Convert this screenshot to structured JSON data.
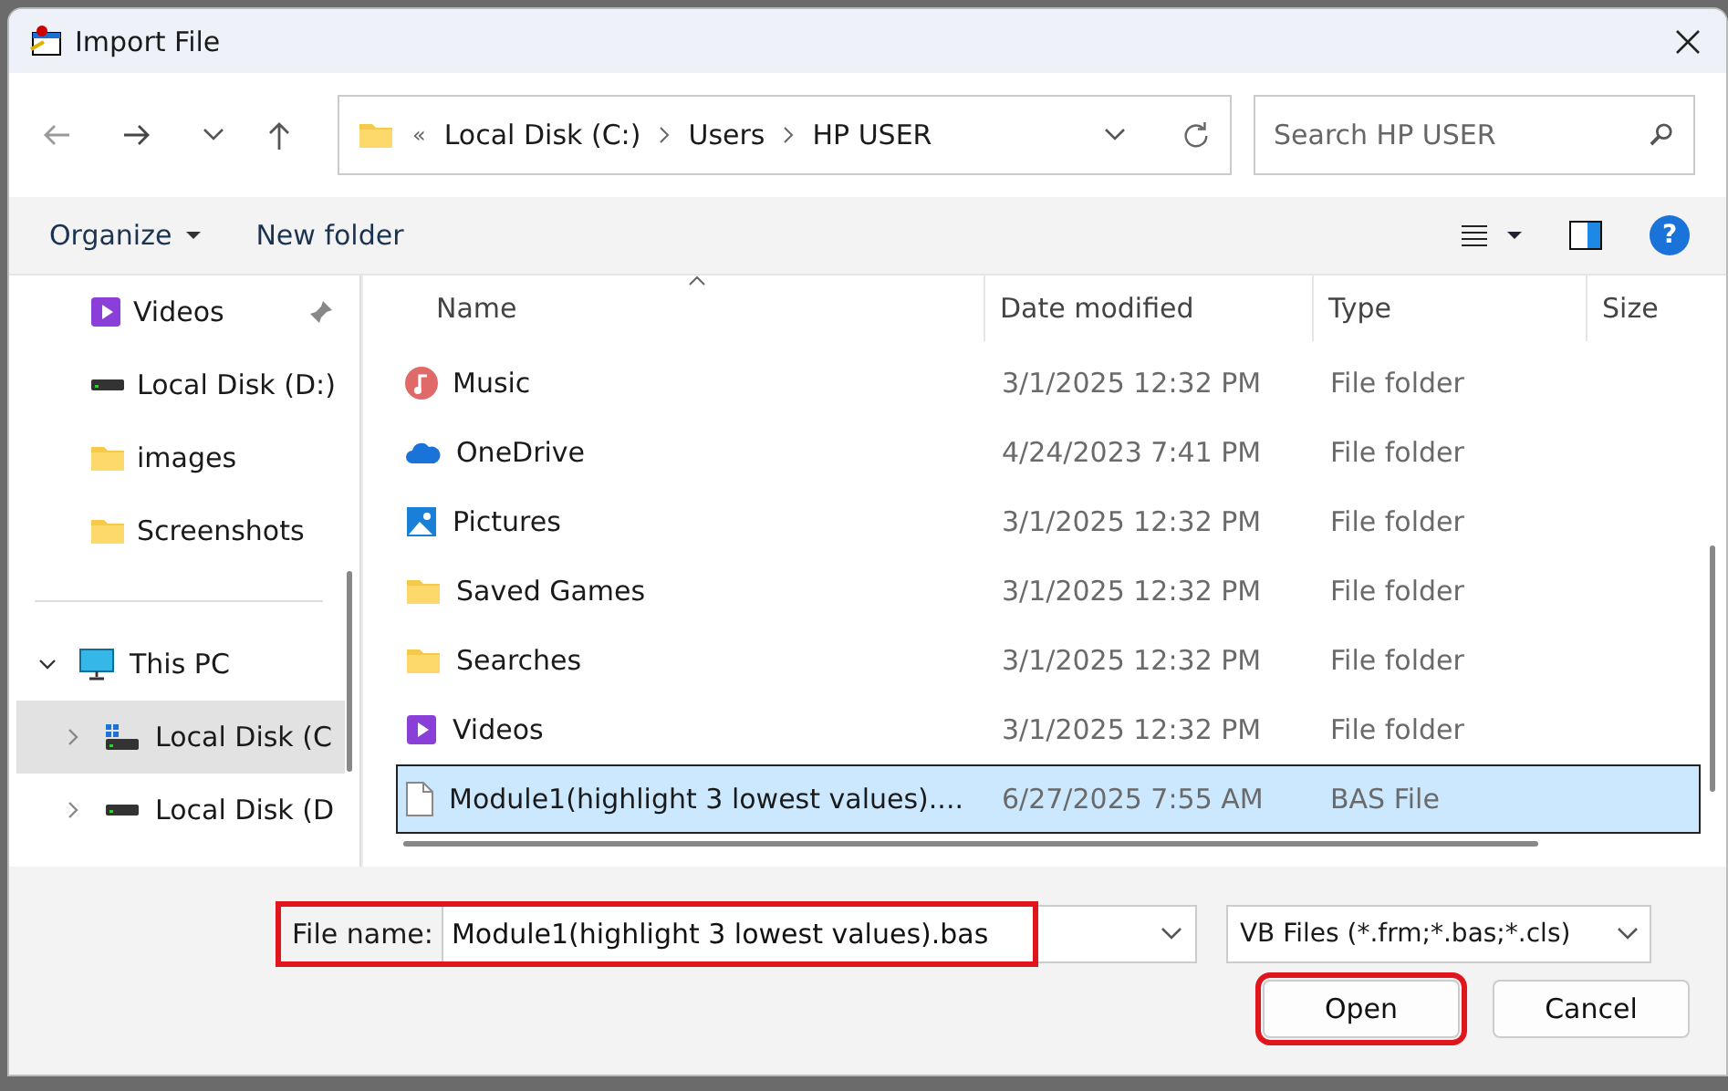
{
  "window": {
    "title": "Import File"
  },
  "address": {
    "overflow": "«",
    "crumbs": [
      "Local Disk (C:)",
      "Users",
      "HP USER"
    ]
  },
  "search": {
    "placeholder": "Search HP USER"
  },
  "toolbar": {
    "organize": "Organize",
    "new_folder": "New folder",
    "help": "?"
  },
  "sidebar": {
    "items": [
      {
        "label": "Videos",
        "kind": "video",
        "pinned": true,
        "selected": false
      },
      {
        "label": "Local Disk (D:)",
        "kind": "drive",
        "pinned": false,
        "selected": false
      },
      {
        "label": "images",
        "kind": "folder",
        "pinned": false,
        "selected": false
      },
      {
        "label": "Screenshots",
        "kind": "folder",
        "pinned": false,
        "selected": false
      }
    ],
    "tree": [
      {
        "label": "This PC",
        "kind": "pc",
        "expanded": true,
        "selected": false,
        "children": [
          {
            "label": "Local Disk (C",
            "kind": "sysdrive",
            "expanded": false,
            "selected": true
          },
          {
            "label": "Local Disk (D",
            "kind": "drive",
            "expanded": false,
            "selected": false
          }
        ]
      }
    ]
  },
  "table": {
    "columns": [
      {
        "label": "Name",
        "sorted": true
      },
      {
        "label": "Date modified",
        "sorted": false
      },
      {
        "label": "Type",
        "sorted": false
      },
      {
        "label": "Size",
        "sorted": false
      }
    ],
    "rows": [
      {
        "name": "Music",
        "kind": "music",
        "date": "3/1/2025 12:32 PM",
        "type": "File folder",
        "selected": false
      },
      {
        "name": "OneDrive",
        "kind": "cloud",
        "date": "4/24/2023 7:41 PM",
        "type": "File folder",
        "selected": false
      },
      {
        "name": "Pictures",
        "kind": "pictures",
        "date": "3/1/2025 12:32 PM",
        "type": "File folder",
        "selected": false
      },
      {
        "name": "Saved Games",
        "kind": "folder",
        "date": "3/1/2025 12:32 PM",
        "type": "File folder",
        "selected": false
      },
      {
        "name": "Searches",
        "kind": "folder",
        "date": "3/1/2025 12:32 PM",
        "type": "File folder",
        "selected": false
      },
      {
        "name": "Videos",
        "kind": "video",
        "date": "3/1/2025 12:32 PM",
        "type": "File folder",
        "selected": false
      },
      {
        "name": "Module1(highlight 3 lowest values)....",
        "kind": "file",
        "date": "6/27/2025 7:55 AM",
        "type": "BAS File",
        "selected": true
      }
    ]
  },
  "file_name": {
    "label": "File name:",
    "value": "Module1(highlight 3 lowest values).bas",
    "highlighted": true
  },
  "file_type": {
    "value": "VB Files (*.frm;*.bas;*.cls)"
  },
  "buttons": [
    {
      "label": "Open",
      "highlighted": true
    },
    {
      "label": "Cancel",
      "highlighted": false
    }
  ]
}
